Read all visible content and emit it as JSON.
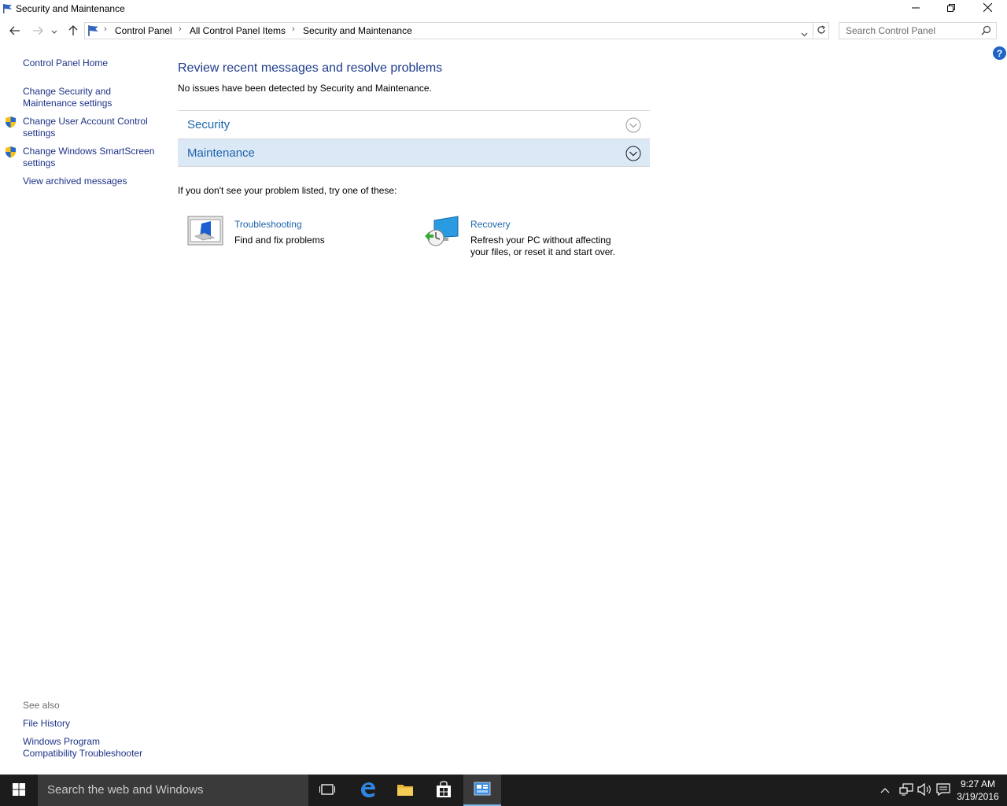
{
  "window": {
    "title": "Security and Maintenance",
    "controls": {
      "minimize": "minimize-icon",
      "restore": "restore-icon",
      "close": "close-icon"
    }
  },
  "address": {
    "crumbs": [
      "Control Panel",
      "All Control Panel Items",
      "Security and Maintenance"
    ],
    "search_placeholder": "Search Control Panel"
  },
  "sidebar": {
    "home": "Control Panel Home",
    "links": [
      {
        "label_line1": "Change Security and",
        "label_line2": "Maintenance settings",
        "shield": false
      },
      {
        "label_line1": "Change User Account Control",
        "label_line2": "settings",
        "shield": true
      },
      {
        "label_line1": "Change Windows SmartScreen",
        "label_line2": "settings",
        "shield": true
      },
      {
        "label_line1": "View archived messages",
        "label_line2": "",
        "shield": false
      }
    ],
    "see_also": "See also",
    "see_also_links": [
      {
        "label_line1": "File History",
        "label_line2": ""
      },
      {
        "label_line1": "Windows Program",
        "label_line2": "Compatibility Troubleshooter"
      }
    ]
  },
  "main": {
    "heading": "Review recent messages and resolve problems",
    "status": "No issues have been detected by Security and Maintenance.",
    "sections": [
      {
        "label": "Security",
        "highlighted": false
      },
      {
        "label": "Maintenance",
        "highlighted": true
      }
    ],
    "try_text": "If you don't see your problem listed, try one of these:",
    "tools": [
      {
        "title": "Troubleshooting",
        "desc_line1": "Find and fix problems",
        "desc_line2": ""
      },
      {
        "title": "Recovery",
        "desc_line1": "Refresh your PC without affecting",
        "desc_line2": "your files, or reset it and start over."
      }
    ]
  },
  "taskbar": {
    "search_text": "Search the web and Windows",
    "time": "9:27 AM",
    "date": "3/19/2016"
  },
  "colors": {
    "link": "#1e3287",
    "section_text": "#1e64aa",
    "heading": "#1e3c8c",
    "maintenance_bg": "#dbe8f6",
    "taskbar": "#1c1c1c"
  }
}
